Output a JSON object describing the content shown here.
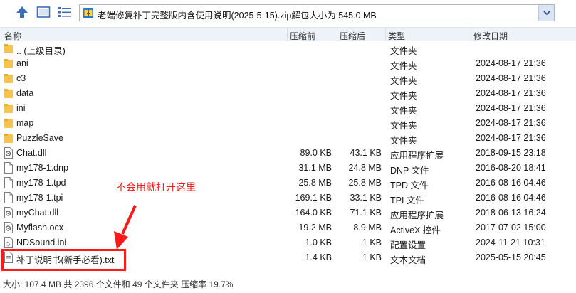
{
  "toolbar": {
    "address_text": "老端修复补丁完整版内含使用说明(2025-5-15).zip解包大小为 545.0 MB"
  },
  "columns": {
    "name": "名称",
    "size": "压缩前",
    "packed": "压缩后",
    "type": "类型",
    "date": "修改日期"
  },
  "files": [
    {
      "name": ".. (上级目录)",
      "size": "",
      "packed": "",
      "type": "文件夹",
      "date": "",
      "icon": "folder-icon"
    },
    {
      "name": "ani",
      "size": "",
      "packed": "",
      "type": "文件夹",
      "date": "2024-08-17 21:36",
      "icon": "folder-icon"
    },
    {
      "name": "c3",
      "size": "",
      "packed": "",
      "type": "文件夹",
      "date": "2024-08-17 21:36",
      "icon": "folder-icon"
    },
    {
      "name": "data",
      "size": "",
      "packed": "",
      "type": "文件夹",
      "date": "2024-08-17 21:36",
      "icon": "folder-icon"
    },
    {
      "name": "ini",
      "size": "",
      "packed": "",
      "type": "文件夹",
      "date": "2024-08-17 21:36",
      "icon": "folder-icon"
    },
    {
      "name": "map",
      "size": "",
      "packed": "",
      "type": "文件夹",
      "date": "2024-08-17 21:36",
      "icon": "folder-icon"
    },
    {
      "name": "PuzzleSave",
      "size": "",
      "packed": "",
      "type": "文件夹",
      "date": "2024-08-17 21:36",
      "icon": "folder-icon"
    },
    {
      "name": "Chat.dll",
      "size": "89.0 KB",
      "packed": "43.1 KB",
      "type": "应用程序扩展",
      "date": "2018-09-15 23:18",
      "icon": "dll-file-icon"
    },
    {
      "name": "my178-1.dnp",
      "size": "31.1 MB",
      "packed": "24.8 MB",
      "type": "DNP 文件",
      "date": "2016-08-20 18:41",
      "icon": "file-icon"
    },
    {
      "name": "my178-1.tpd",
      "size": "25.8 MB",
      "packed": "25.8 MB",
      "type": "TPD 文件",
      "date": "2016-08-16 04:46",
      "icon": "file-icon"
    },
    {
      "name": "my178-1.tpi",
      "size": "169.1 KB",
      "packed": "33.1 KB",
      "type": "TPI 文件",
      "date": "2016-08-16 04:46",
      "icon": "file-icon"
    },
    {
      "name": "myChat.dll",
      "size": "164.0 KB",
      "packed": "71.1 KB",
      "type": "应用程序扩展",
      "date": "2018-06-13 16:24",
      "icon": "dll-file-icon"
    },
    {
      "name": "Myflash.ocx",
      "size": "19.2 MB",
      "packed": "8.9 MB",
      "type": "ActiveX 控件",
      "date": "2017-07-02 15:00",
      "icon": "dll-file-icon"
    },
    {
      "name": "NDSound.ini",
      "size": "1.0 KB",
      "packed": "1 KB",
      "type": "配置设置",
      "date": "2024-11-21 10:31",
      "icon": "ini-file-icon"
    },
    {
      "name": "补丁说明书(新手必看).txt",
      "size": "1.4 KB",
      "packed": "1 KB",
      "type": "文本文档",
      "date": "2025-05-15 20:45",
      "icon": "text-file-icon"
    }
  ],
  "status": "大小: 107.4 MB 共 2396 个文件和 49 个文件夹 压缩率 19.7%",
  "annotation": {
    "text": "不会用就打开这里",
    "color": "#ff1a1a"
  }
}
